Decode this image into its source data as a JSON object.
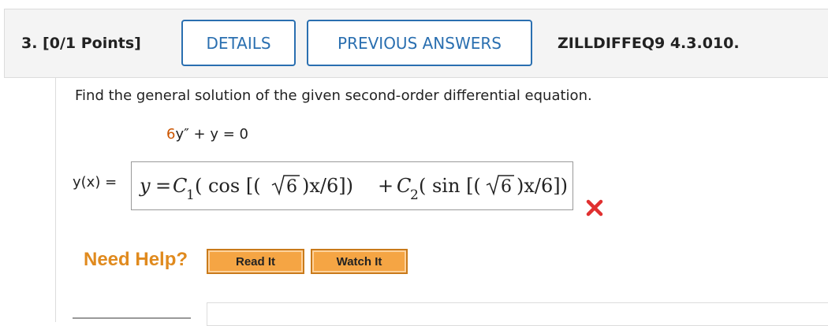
{
  "header": {
    "question_label": "3. [0/1 Points]",
    "details_button": "DETAILS",
    "previous_answers_button": "PREVIOUS ANSWERS",
    "problem_code": "ZILLDIFFEQ9 4.3.010."
  },
  "problem": {
    "prompt": "Find the general solution of the given second-order differential equation.",
    "equation_coeff": "6",
    "equation_rest": "y″ + y = 0"
  },
  "answer": {
    "label": "y(x) =",
    "entered": "y = C₁( cos [(√6 )x/6]) + C₂( sin [(√6 )x/6])",
    "parts": {
      "lhs": "y",
      "eq": "=",
      "c": "C",
      "sub1": "1",
      "sub2": "2",
      "cos_open": "( cos [(",
      "sin_open": "( sin [(",
      "radicand": "6",
      "tail": ")x/6])",
      "plus": "+"
    },
    "status": "incorrect",
    "status_color": "#e03030"
  },
  "help": {
    "label": "Need Help?",
    "read_button": "Read It",
    "watch_button": "Watch It"
  },
  "colors": {
    "accent": "#2a6fb0",
    "equation_coeff": "#cc5500",
    "need_help": "#e08a1e",
    "help_button": "#f5a544"
  }
}
